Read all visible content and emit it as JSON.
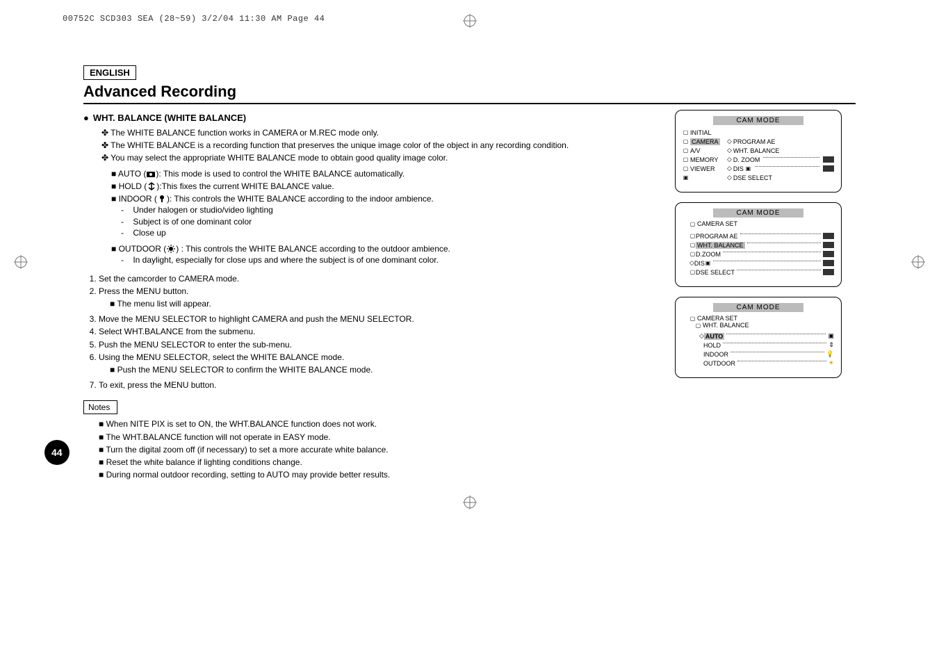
{
  "meta_header": "00752C SCD303 SEA (28~59)  3/2/04 11:30 AM  Page 44",
  "lang_box": "ENGLISH",
  "title": "Advanced Recording",
  "section_heading": "WHT. BALANCE (WHITE BALANCE)",
  "bullets": [
    "The WHITE BALANCE function works in CAMERA or M.REC mode only.",
    "The WHITE BALANCE is a recording function that preserves the unique image color of the object in any recording condition.",
    "You may select the appropriate WHITE BALANCE mode to obtain good quality image color."
  ],
  "modes": {
    "auto": "AUTO (      ): This mode is used to control the WHITE BALANCE automatically.",
    "hold": "HOLD (      ):This fixes the current WHITE BALANCE value.",
    "indoor": "INDOOR (      ): This controls the WHITE BALANCE according to the indoor ambience.",
    "outdoor": "OUTDOOR (      ) : This controls the WHITE BALANCE according to the outdoor ambience."
  },
  "indoor_sub": [
    "Under halogen or studio/video lighting",
    "Subject is of one dominant color",
    "Close up"
  ],
  "outdoor_sub": [
    "In daylight, especially for close ups and where the subject is of one dominant color."
  ],
  "steps": [
    "Set the camcorder to CAMERA mode.",
    "Press the MENU button.",
    "Move the MENU SELECTOR to highlight CAMERA and push the MENU SELECTOR.",
    "Select WHT.BALANCE from the submenu.",
    "Push the MENU SELECTOR to enter the sub-menu.",
    "Using the MENU SELECTOR, select the WHITE BALANCE mode.",
    "To exit, press the MENU button."
  ],
  "step2_sub": "The menu list will appear.",
  "step6_sub": "Push the MENU SELECTOR to confirm the WHITE BALANCE mode.",
  "notes_label": "Notes",
  "notes": [
    "When NITE PIX is set to ON, the WHT.BALANCE function does not work.",
    "The WHT.BALANCE function will not operate in EASY mode.",
    "Turn the digital zoom off (if necessary) to set a more accurate white balance.",
    "Reset the white balance if lighting conditions change.",
    "During normal outdoor recording, setting to AUTO may provide better results."
  ],
  "osd": {
    "title": "CAM  MODE",
    "panel1": {
      "left": [
        "INITIAL",
        "CAMERA",
        "A/V",
        "MEMORY",
        "VIEWER"
      ],
      "right": [
        "PROGRAM AE",
        "WHT. BALANCE",
        "D. ZOOM",
        "DIS",
        "DSE SELECT"
      ]
    },
    "panel2": {
      "heading": "CAMERA SET",
      "items": [
        "PROGRAM AE",
        "WHT. BALANCE",
        "D.ZOOM",
        "DIS",
        "DSE SELECT"
      ]
    },
    "panel3": {
      "heading": "CAMERA SET",
      "subheading": "WHT. BALANCE",
      "items": [
        "AUTO",
        "HOLD",
        "INDOOR",
        "OUTDOOR"
      ]
    }
  },
  "page_number": "44"
}
